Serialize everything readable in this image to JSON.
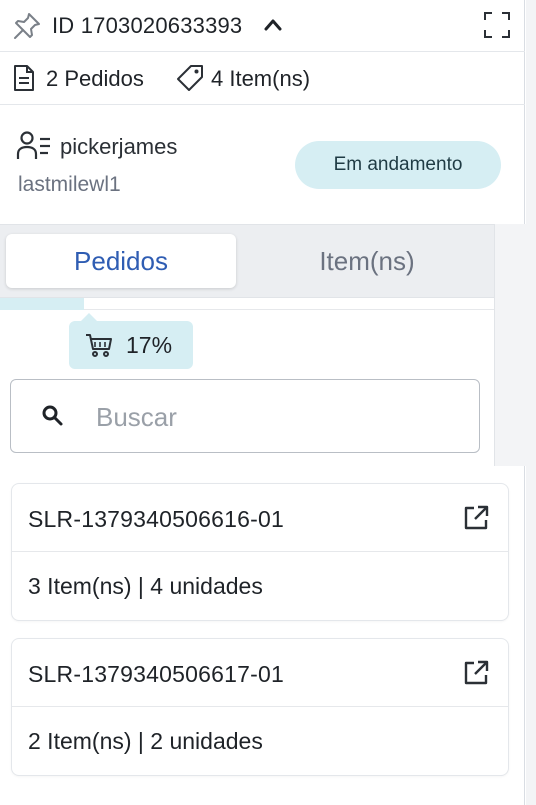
{
  "header": {
    "id_label": "ID 1703020633393",
    "pin_icon": "pin-icon",
    "chevron_icon": "chevron-up-icon",
    "expand_icon": "expand-icon"
  },
  "counts": {
    "orders": "2 Pedidos",
    "items": "4 Item(ns)"
  },
  "user": {
    "name": "pickerjames",
    "wave": "lastmilewl1",
    "status": "Em andamento"
  },
  "tabs": [
    {
      "label": "Pedidos",
      "active": true
    },
    {
      "label": "Item(ns)",
      "active": false
    }
  ],
  "progress": {
    "value": 0.17,
    "label": "17%"
  },
  "search": {
    "placeholder": "Buscar",
    "value": ""
  },
  "orders": [
    {
      "code": "SLR-1379340506616-01",
      "summary": "3 Item(ns) | 4 unidades"
    },
    {
      "code": "SLR-1379340506617-01",
      "summary": "2 Item(ns) | 2 unidades"
    }
  ],
  "colors": {
    "accent_blue": "#2f5db3",
    "badge_bg": "#d6eef3"
  }
}
